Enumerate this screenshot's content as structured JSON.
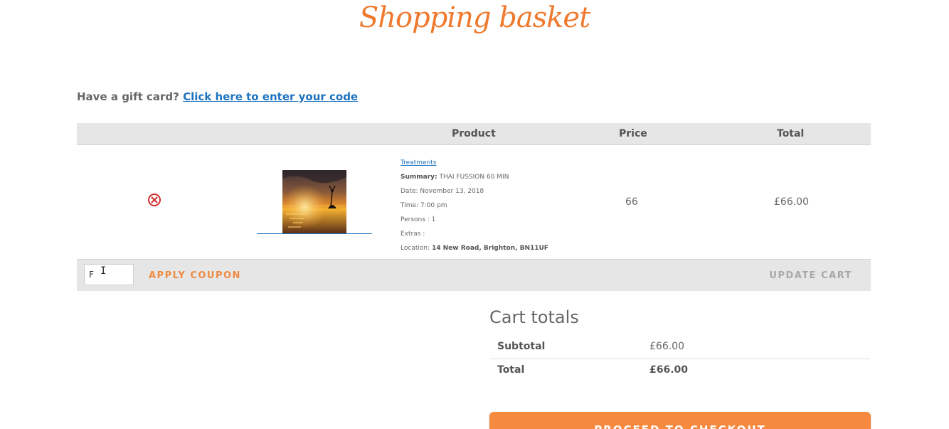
{
  "page": {
    "title": "Shopping basket"
  },
  "gift_card": {
    "prompt": "Have a gift card?",
    "link_text": "Click here to enter your code"
  },
  "cart": {
    "columns": [
      "Product",
      "Price",
      "Total"
    ],
    "items": [
      {
        "category": "Treatments",
        "summary_label": "Summary:",
        "summary_value": "THAI FUSSION 60 MIN",
        "date": "Date: November 13, 2018",
        "time": "Time: 7:00 pm",
        "persons": "Persons : 1",
        "extras": "Extras :",
        "location_label": "Location:",
        "location_value": "14 New Road, Brighton, BN11UF",
        "price": "66",
        "total": "£66.00"
      }
    ],
    "coupon": {
      "value": "F",
      "button": "APPLY COUPON"
    },
    "update_button": "UPDATE CART"
  },
  "cart_totals": {
    "title": "Cart totals",
    "subtotal_label": "Subtotal",
    "subtotal_value": "£66.00",
    "total_label": "Total",
    "total_value": "£66.00"
  },
  "checkout": {
    "button": "PROCEED TO CHECKOUT"
  },
  "colors": {
    "accent": "#ef7a2e",
    "link": "#1e73be",
    "remove": "#d32f2f",
    "bar": "#e6e6e6"
  }
}
